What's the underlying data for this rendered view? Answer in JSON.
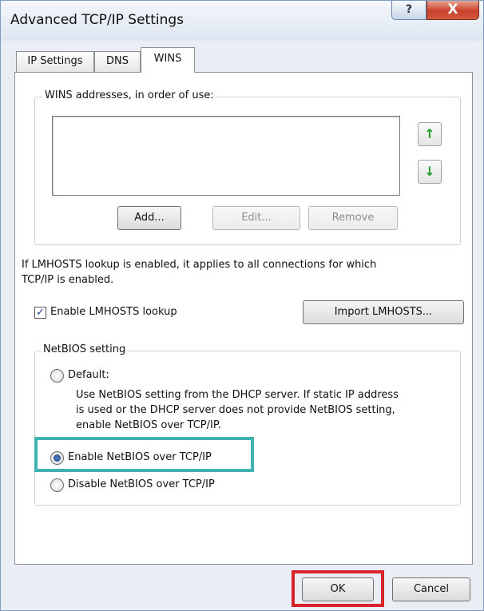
{
  "window": {
    "title": "Advanced TCP/IP Settings",
    "help_label": "?",
    "close_label": "X"
  },
  "tabs": [
    {
      "label": "IP Settings",
      "active": false
    },
    {
      "label": "DNS",
      "active": false
    },
    {
      "label": "WINS",
      "active": true
    }
  ],
  "wins": {
    "group_title": "WINS addresses, in order of use:",
    "up_arrow": "↑",
    "down_arrow": "↓",
    "add_label": "Add...",
    "edit_label": "Edit...",
    "remove_label": "Remove"
  },
  "lmhosts": {
    "info_line1": "If LMHOSTS lookup is enabled, it applies to all connections for which",
    "info_line2": "TCP/IP is enabled.",
    "enable_label": "Enable LMHOSTS lookup",
    "enable_checked": true,
    "check_mark": "✓",
    "import_label": "Import LMHOSTS..."
  },
  "netbios": {
    "group_title": "NetBIOS setting",
    "default_label": "Default:",
    "default_desc_line1": "Use NetBIOS setting from the DHCP server. If static IP address",
    "default_desc_line2": "is used or the DHCP server does not provide NetBIOS setting,",
    "default_desc_line3": "enable NetBIOS over TCP/IP.",
    "enable_label": "Enable NetBIOS over TCP/IP",
    "disable_label": "Disable NetBIOS over TCP/IP",
    "selected": "enable"
  },
  "footer": {
    "ok_label": "OK",
    "cancel_label": "Cancel"
  },
  "colors": {
    "highlight_teal": "#3fb3ad",
    "highlight_red": "#d8232a",
    "arrow_green": "#1f9a2a"
  }
}
